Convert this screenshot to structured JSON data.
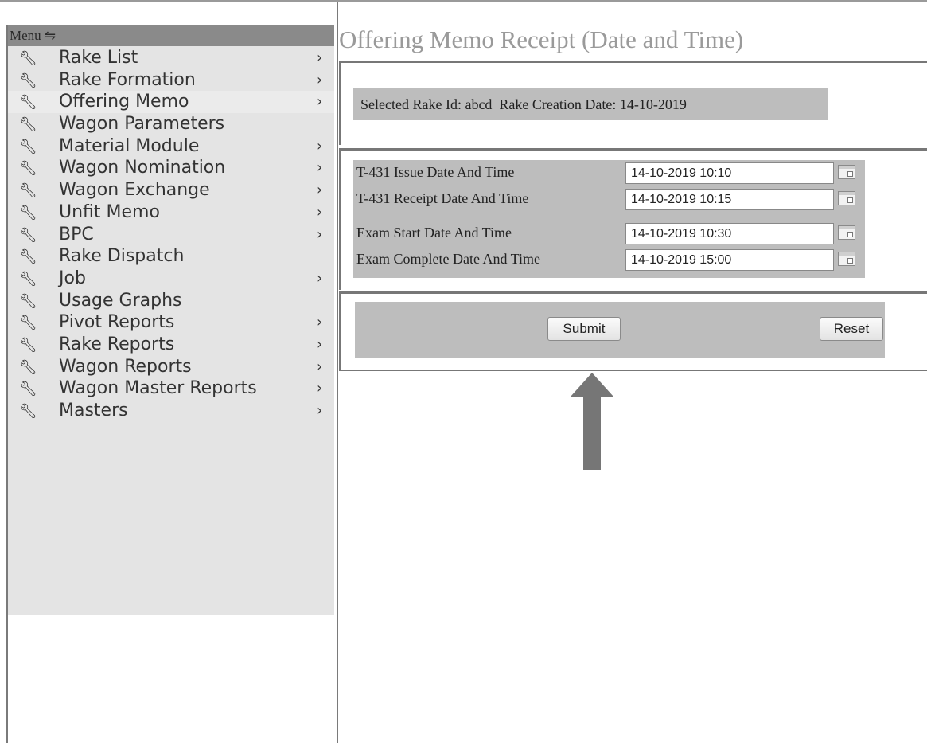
{
  "menu": {
    "header": "Menu",
    "header_icon": "⇋",
    "items": [
      {
        "label": "Rake List",
        "chevron": "›"
      },
      {
        "label": "Rake Formation",
        "chevron": "›"
      },
      {
        "label": "Offering Memo",
        "chevron": "›"
      },
      {
        "label": "Wagon Parameters",
        "chevron": ""
      },
      {
        "label": "Material Module",
        "chevron": "›"
      },
      {
        "label": "Wagon Nomination",
        "chevron": "›"
      },
      {
        "label": "Wagon Exchange",
        "chevron": "›"
      },
      {
        "label": "Unfit Memo",
        "chevron": "›"
      },
      {
        "label": "BPC",
        "chevron": "›"
      },
      {
        "label": "Rake Dispatch",
        "chevron": ""
      },
      {
        "label": "Job",
        "chevron": "›"
      },
      {
        "label": "Usage Graphs",
        "chevron": ""
      },
      {
        "label": "Pivot Reports",
        "chevron": "›"
      },
      {
        "label": "Rake Reports",
        "chevron": "›"
      },
      {
        "label": "Wagon Reports",
        "chevron": "›"
      },
      {
        "label": "Wagon Master Reports",
        "chevron": "›"
      },
      {
        "label": "Masters",
        "chevron": "›"
      }
    ]
  },
  "main": {
    "title": "Offering Memo Receipt (Date and Time)",
    "rake_info": "Selected Rake Id: abcd  Rake Creation Date: 14-10-2019",
    "fields": [
      {
        "label": "T-431 Issue Date And Time",
        "value": "14-10-2019 10:10"
      },
      {
        "label": "T-431 Receipt Date And Time",
        "value": "14-10-2019 10:15"
      },
      {
        "label": "Exam Start Date And Time",
        "value": "14-10-2019 10:30"
      },
      {
        "label": "Exam Complete Date And Time",
        "value": "14-10-2019 15:00"
      }
    ],
    "submit_label": "Submit",
    "reset_label": "Reset"
  },
  "colors": {
    "panel_gray": "#bdbdbd",
    "header_gray": "#8a8a8a",
    "arrow_gray": "#767676"
  }
}
